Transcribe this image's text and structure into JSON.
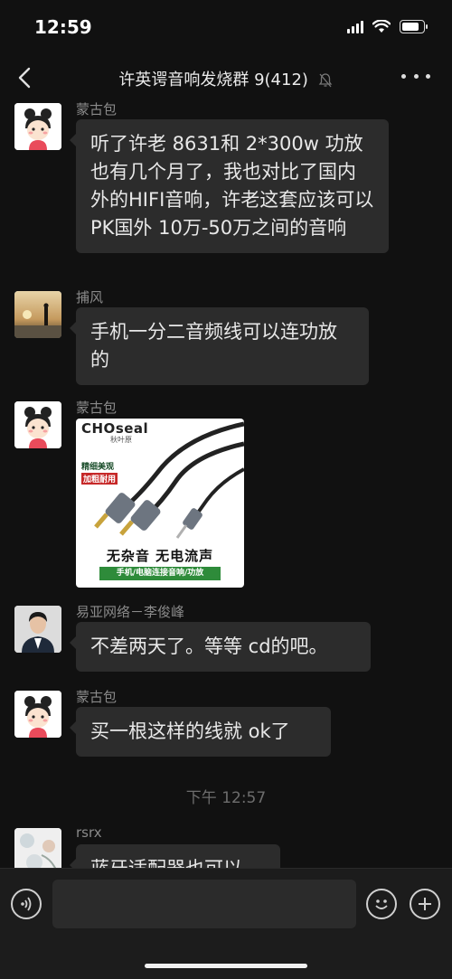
{
  "status_bar": {
    "time": "12:59"
  },
  "header": {
    "title": "许英谔音响发烧群 9(412)"
  },
  "messages": [
    {
      "sender": "蒙古包",
      "text": "听了许老 8631和 2*300w 功放也有几个月了，我也对比了国内外的HIFI音响，许老这套应该可以PK国外 10万-50万之间的音响"
    },
    {
      "sender": "捕风",
      "text": "手机一分二音频线可以连功放的"
    },
    {
      "sender": "蒙古包",
      "image": {
        "brand": "CHOseal",
        "brand_sub": "秋叶原",
        "tag1": "精细美观",
        "tag2": "加粗耐用",
        "headline": "无杂音  无电流声",
        "banner": "手机/电脑连接音响/功放"
      }
    },
    {
      "sender": "易亚网络－李俊峰",
      "text": "不差两天了。等等 cd的吧。"
    },
    {
      "sender": "蒙古包",
      "text": "买一根这样的线就 ok了"
    },
    {
      "timestamp": "下午 12:57"
    },
    {
      "sender": "rsrx",
      "text": "蓝牙适配器也可以"
    }
  ],
  "colors": {
    "background": "#111111",
    "bubble": "#2c2c2c",
    "accent_banner": "#2e8b3a"
  }
}
